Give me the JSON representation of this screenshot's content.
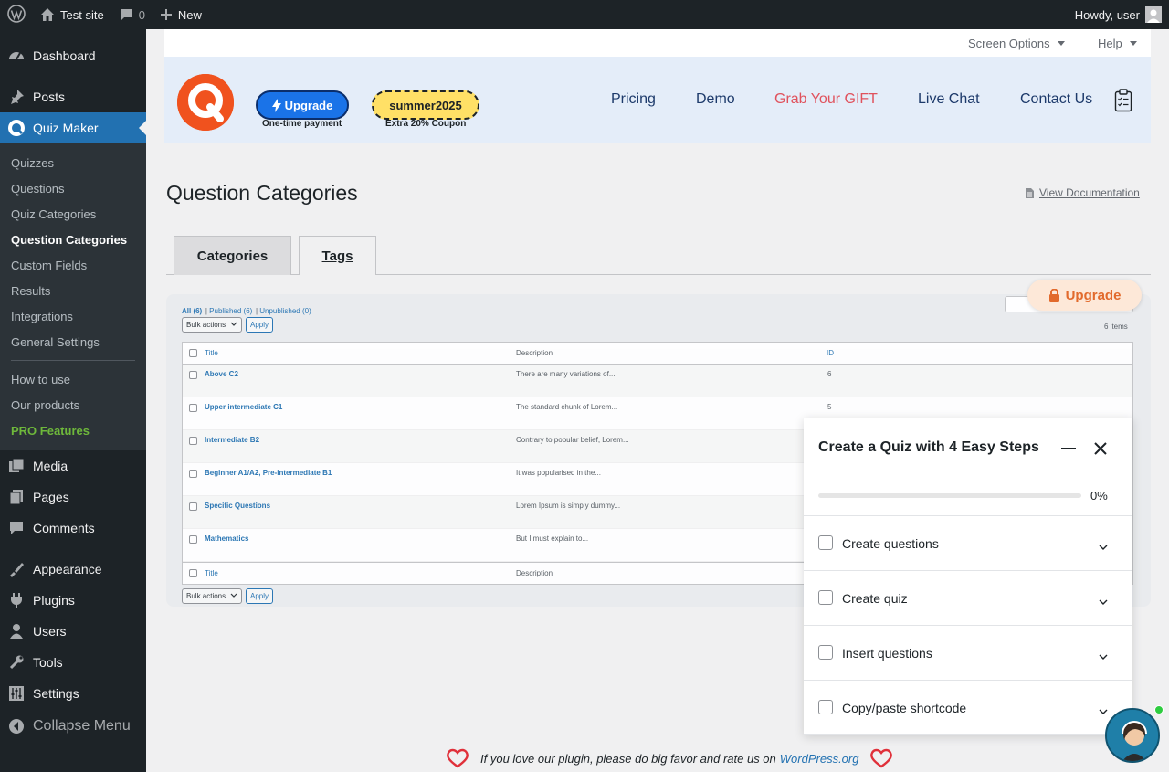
{
  "adminbar": {
    "site_name": "Test site",
    "comments_count": "0",
    "new_label": "New",
    "howdy": "Howdy, user"
  },
  "sidebar": {
    "items": [
      {
        "label": "Dashboard",
        "icon": "dashboard-icon"
      },
      {
        "label": "Posts",
        "icon": "pin-icon"
      },
      {
        "label": "Quiz Maker",
        "icon": "quiz-maker-icon",
        "current": true
      }
    ],
    "submenu": [
      {
        "label": "Quizzes"
      },
      {
        "label": "Questions"
      },
      {
        "label": "Quiz Categories"
      },
      {
        "label": "Question Categories",
        "current": true
      },
      {
        "label": "Custom Fields"
      },
      {
        "label": "Results"
      },
      {
        "label": "Integrations"
      },
      {
        "label": "General Settings"
      },
      {
        "label": "How to use"
      },
      {
        "label": "Our products"
      },
      {
        "label": "PRO Features"
      }
    ],
    "lower_items": [
      {
        "label": "Media",
        "icon": "media-icon"
      },
      {
        "label": "Pages",
        "icon": "pages-icon"
      },
      {
        "label": "Comments",
        "icon": "comments-icon"
      },
      {
        "label": "Appearance",
        "icon": "appearance-icon"
      },
      {
        "label": "Plugins",
        "icon": "plugins-icon"
      },
      {
        "label": "Users",
        "icon": "users-icon"
      },
      {
        "label": "Tools",
        "icon": "tools-icon"
      },
      {
        "label": "Settings",
        "icon": "settings-icon"
      }
    ],
    "collapse_label": "Collapse Menu"
  },
  "screen_meta": {
    "screen_options": "Screen Options",
    "help": "Help"
  },
  "promo": {
    "upgrade_label": "Upgrade",
    "upgrade_sub": "One-time payment",
    "coupon_code": "summer2025",
    "coupon_sub": "Extra 20% Coupon",
    "nav": {
      "pricing": "Pricing",
      "demo": "Demo",
      "gift": "Grab Your GIFT",
      "live_chat": "Live Chat",
      "contact": "Contact Us"
    }
  },
  "page": {
    "title": "Question Categories",
    "docs_link": "View Documentation"
  },
  "tabs": [
    {
      "label": "Categories",
      "active": true
    },
    {
      "label": "Tags",
      "active": false
    }
  ],
  "preview": {
    "filters": {
      "all": "All (6)",
      "published": "Published (6)",
      "unpublished": "Unpublished (0)"
    },
    "bulk_actions": "Bulk actions",
    "apply": "Apply",
    "items_count": "6 items",
    "columns": {
      "title": "Title",
      "description": "Description",
      "id": "ID"
    },
    "rows": [
      {
        "title": "Above C2",
        "description": "There are many variations of...",
        "id": "6"
      },
      {
        "title": "Upper intermediate C1",
        "description": "The standard chunk of Lorem...",
        "id": "5"
      },
      {
        "title": "Intermediate B2",
        "description": "Contrary to popular belief, Lorem...",
        "id": ""
      },
      {
        "title": "Beginner A1/A2, Pre-intermediate B1",
        "description": "It was popularised in the...",
        "id": ""
      },
      {
        "title": "Specific Questions",
        "description": "Lorem Ipsum is simply dummy...",
        "id": ""
      },
      {
        "title": "Mathematics",
        "description": "But I must explain to...",
        "id": ""
      }
    ],
    "pro_upgrade": "Upgrade"
  },
  "steps_panel": {
    "title": "Create a Quiz with 4 Easy Steps",
    "progress_percent": 0,
    "progress_label": "0%",
    "steps": [
      {
        "label": "Create questions"
      },
      {
        "label": "Create quiz"
      },
      {
        "label": "Insert questions"
      },
      {
        "label": "Copy/paste shortcode"
      }
    ]
  },
  "footer": {
    "love_text": "If you love our plugin, please do big favor and rate us on",
    "wp_link": "WordPress.org"
  },
  "colors": {
    "accent": "#2271b1",
    "sidebar": "#1d2327",
    "brand_orange": "#f0521e",
    "gift_red": "#e0525d",
    "pro_green": "#6eb83b",
    "heart_red": "#e0303a"
  }
}
